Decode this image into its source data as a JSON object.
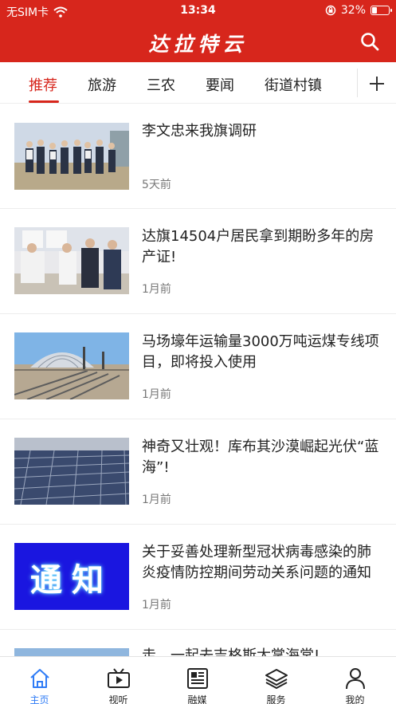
{
  "status_bar": {
    "carrier": "无SIM卡",
    "time": "13:34",
    "battery": "32%",
    "battery_level": 0.32
  },
  "header": {
    "title": "达拉特云",
    "search_icon": "search-icon"
  },
  "tabs": [
    {
      "label": "推荐",
      "active": true
    },
    {
      "label": "旅游",
      "active": false
    },
    {
      "label": "三农",
      "active": false
    },
    {
      "label": "要闻",
      "active": false
    },
    {
      "label": "街道村镇",
      "active": false
    }
  ],
  "news": [
    {
      "title": "李文忠来我旗调研",
      "time": "5天前"
    },
    {
      "title": "达旗14504户居民拿到期盼多年的房产证!",
      "time": "1月前"
    },
    {
      "title": "马场壕年运输量3000万吨运煤专线项目，即将投入使用",
      "time": "1月前"
    },
    {
      "title": "神奇又壮观！库布其沙漠崛起光伏“蓝海”!",
      "time": "1月前"
    },
    {
      "title": "关于妥善处理新型冠状病毒感染的肺炎疫情防控期间劳动关系问题的通知",
      "time": "1月前",
      "thumb_text": "通知"
    },
    {
      "title": "走，一起去吉格斯太掌海棠!",
      "time": ""
    }
  ],
  "tabbar": [
    {
      "label": "主页",
      "icon": "home-icon",
      "active": true
    },
    {
      "label": "视听",
      "icon": "video-icon",
      "active": false
    },
    {
      "label": "融媒",
      "icon": "newspaper-icon",
      "active": false
    },
    {
      "label": "服务",
      "icon": "layers-icon",
      "active": false
    },
    {
      "label": "我的",
      "icon": "user-icon",
      "active": false
    }
  ],
  "colors": {
    "brand": "#d7261c",
    "active_tab": "#2f7cf6",
    "text": "#222222",
    "muted": "#777777"
  }
}
